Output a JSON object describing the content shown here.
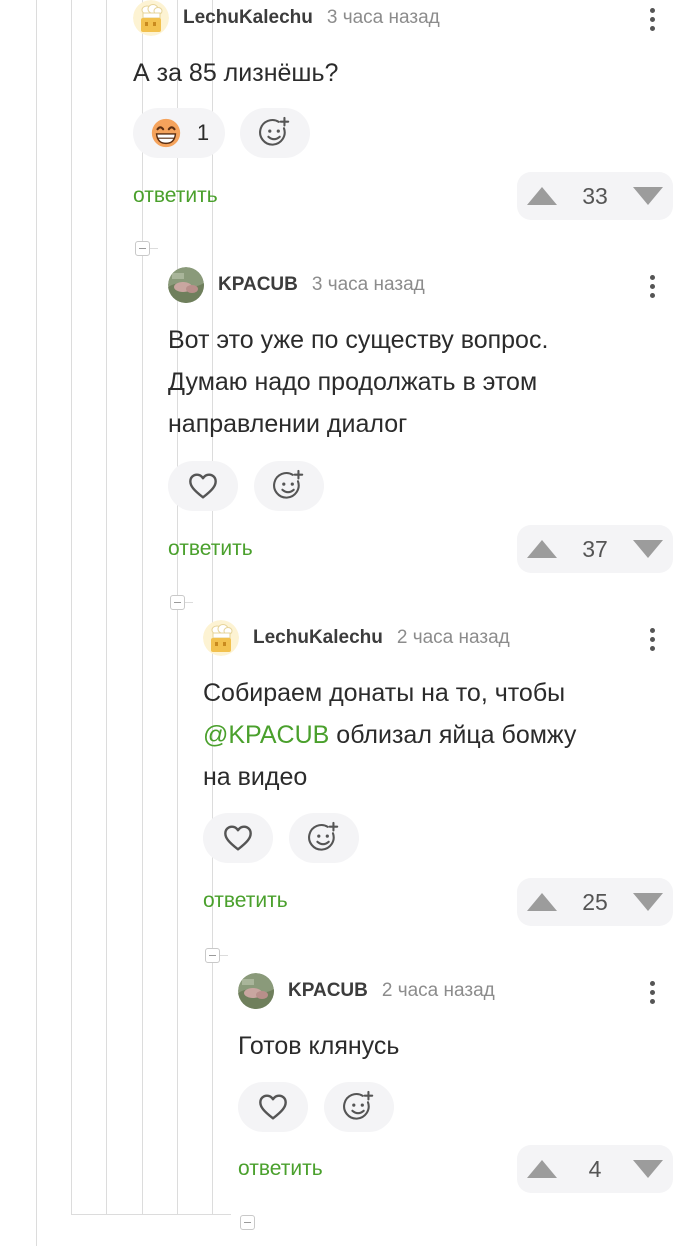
{
  "colors": {
    "accent_green": "#4aa02c",
    "pill_bg": "#f4f4f6",
    "line": "#dcdcdc",
    "emoji_face": "#f5a35c"
  },
  "comments": [
    {
      "author": "LechuKalechu",
      "time": "3 часа назад",
      "avatar_icon": "chef-hat-icon",
      "text_lines": [
        "А за 85 лизнёшь?"
      ],
      "reaction": {
        "icon": "grinning-face-icon",
        "count": "1"
      },
      "add_reaction_icon": "smile-plus-icon",
      "reply_label": "ответить",
      "score": "33"
    },
    {
      "author": "KPACUB",
      "time": "3 часа назад",
      "avatar_icon": "photo-avatar-icon",
      "text_lines": [
        "Вот это уже по существу вопрос.",
        "Думаю надо продолжать в этом",
        "направлении диалог"
      ],
      "reaction": {
        "icon": "heart-icon"
      },
      "add_reaction_icon": "smile-plus-icon",
      "reply_label": "ответить",
      "score": "37"
    },
    {
      "author": "LechuKalechu",
      "time": "2 часа назад",
      "avatar_icon": "chef-hat-icon",
      "text_lines": [
        "Собираем донаты на то, чтобы",
        "облизал яйца бомжу",
        "на видео"
      ],
      "mention": "@KPACUB",
      "reaction": {
        "icon": "heart-icon"
      },
      "add_reaction_icon": "smile-plus-icon",
      "reply_label": "ответить",
      "score": "25"
    },
    {
      "author": "KPACUB",
      "time": "2 часа назад",
      "avatar_icon": "photo-avatar-icon",
      "text_lines": [
        "Готов клянусь"
      ],
      "reaction": {
        "icon": "heart-icon"
      },
      "add_reaction_icon": "smile-plus-icon",
      "reply_label": "ответить",
      "score": "4"
    }
  ]
}
